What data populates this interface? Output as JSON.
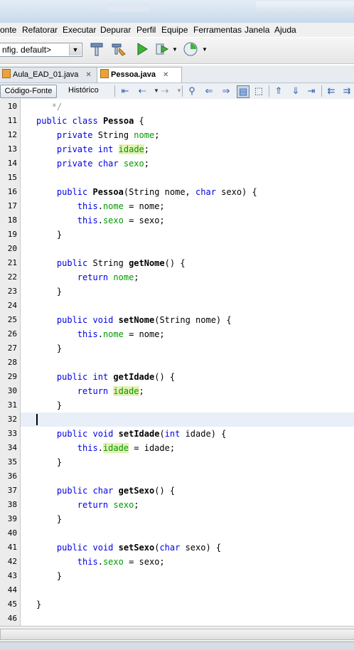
{
  "menu": [
    "onte",
    "Refatorar",
    "Executar",
    "Depurar",
    "Perfil",
    "Equipe",
    "Ferramentas",
    "Janela",
    "Ajuda"
  ],
  "toolbar": {
    "config": "nfig. default>"
  },
  "tabs": [
    {
      "label": "Aula_EAD_01.java",
      "active": false
    },
    {
      "label": "Pessoa.java",
      "active": true
    }
  ],
  "editor_toolbar": {
    "source": "Código-Fonte",
    "history": "Histórico"
  },
  "icons": [
    "hammer-icon",
    "clean-build-icon",
    "run-icon",
    "debug-icon",
    "profile-icon",
    "search-icon",
    "prev-occurrence-icon",
    "next-occurrence-icon",
    "toggle-highlight-icon",
    "bookmark-prev-icon",
    "bookmark-next-icon",
    "shift-left-icon",
    "shift-right-icon"
  ],
  "colors": {
    "keyword": "#0000e6",
    "field": "#009900",
    "highlight": "#e4f1b4"
  },
  "lines": [
    {
      "n": "10",
      "t": "   */"
    },
    {
      "n": "11",
      "t": "public class Pessoa {"
    },
    {
      "n": "12",
      "t": "    private String nome;"
    },
    {
      "n": "13",
      "t": "    private int idade;"
    },
    {
      "n": "14",
      "t": "    private char sexo;"
    },
    {
      "n": "15",
      "t": ""
    },
    {
      "n": "16",
      "t": "    public Pessoa(String nome, char sexo) {"
    },
    {
      "n": "17",
      "t": "        this.nome = nome;"
    },
    {
      "n": "18",
      "t": "        this.sexo = sexo;"
    },
    {
      "n": "19",
      "t": "    }"
    },
    {
      "n": "20",
      "t": ""
    },
    {
      "n": "21",
      "t": "    public String getNome() {"
    },
    {
      "n": "22",
      "t": "        return nome;"
    },
    {
      "n": "23",
      "t": "    }"
    },
    {
      "n": "24",
      "t": ""
    },
    {
      "n": "25",
      "t": "    public void setNome(String nome) {"
    },
    {
      "n": "26",
      "t": "        this.nome = nome;"
    },
    {
      "n": "27",
      "t": "    }"
    },
    {
      "n": "28",
      "t": ""
    },
    {
      "n": "29",
      "t": "    public int getIdade() {"
    },
    {
      "n": "30",
      "t": "        return idade;"
    },
    {
      "n": "31",
      "t": "    }"
    },
    {
      "n": "32",
      "t": ""
    },
    {
      "n": "33",
      "t": "    public void setIdade(int idade) {"
    },
    {
      "n": "34",
      "t": "        this.idade = idade;"
    },
    {
      "n": "35",
      "t": "    }"
    },
    {
      "n": "36",
      "t": ""
    },
    {
      "n": "37",
      "t": "    public char getSexo() {"
    },
    {
      "n": "38",
      "t": "        return sexo;"
    },
    {
      "n": "39",
      "t": "    }"
    },
    {
      "n": "40",
      "t": ""
    },
    {
      "n": "41",
      "t": "    public void setSexo(char sexo) {"
    },
    {
      "n": "42",
      "t": "        this.sexo = sexo;"
    },
    {
      "n": "43",
      "t": "    }"
    },
    {
      "n": "44",
      "t": ""
    },
    {
      "n": "45",
      "t": "}"
    },
    {
      "n": "46",
      "t": ""
    }
  ],
  "current_line": "32",
  "fold_lines": [
    "16",
    "21",
    "25",
    "29",
    "33",
    "37",
    "41"
  ]
}
